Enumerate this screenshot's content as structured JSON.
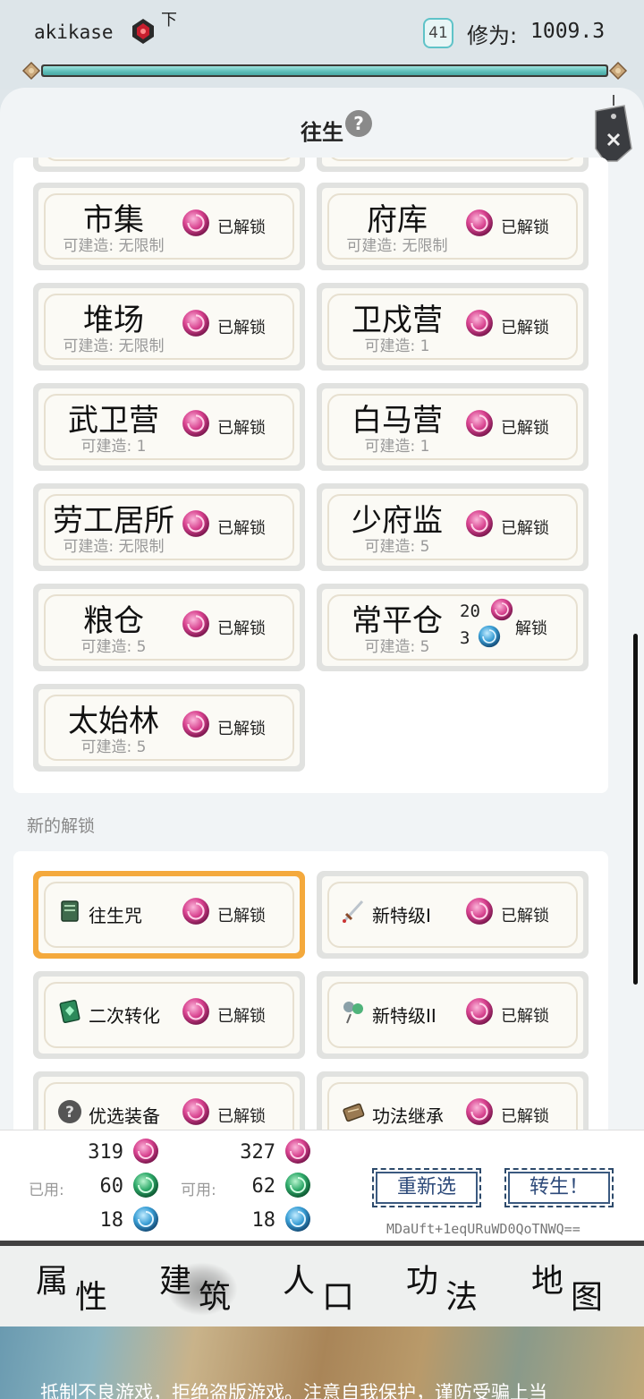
{
  "header": {
    "username": "akikase",
    "realm": "下",
    "level": "41",
    "cultivation_label": "修为:",
    "cultivation_value": "1009.3",
    "progress": 1.0
  },
  "panel": {
    "title": "往生",
    "help": "?"
  },
  "buildings": [
    {
      "name": "市集",
      "sub": "可建造: 无限制",
      "status": "已解锁"
    },
    {
      "name": "府库",
      "sub": "可建造: 无限制",
      "status": "已解锁"
    },
    {
      "name": "堆场",
      "sub": "可建造: 无限制",
      "status": "已解锁"
    },
    {
      "name": "卫戍营",
      "sub": "可建造: 1",
      "status": "已解锁"
    },
    {
      "name": "武卫营",
      "sub": "可建造: 1",
      "status": "已解锁"
    },
    {
      "name": "白马营",
      "sub": "可建造: 1",
      "status": "已解锁"
    },
    {
      "name": "劳工居所",
      "sub": "可建造: 无限制",
      "status": "已解锁"
    },
    {
      "name": "少府监",
      "sub": "可建造: 5",
      "status": "已解锁"
    },
    {
      "name": "粮仓",
      "sub": "可建造: 5",
      "status": "已解锁"
    },
    {
      "name": "常平仓",
      "sub": "可建造: 5",
      "status": "解锁",
      "cost1": "20",
      "cost2": "3"
    },
    {
      "name": "太始林",
      "sub": "可建造: 5",
      "status": "已解锁"
    }
  ],
  "new_unlocks_label": "新的解锁",
  "unlocks": [
    {
      "name": "往生咒",
      "status": "已解锁",
      "icon": "book-icon"
    },
    {
      "name": "新特级I",
      "status": "已解锁",
      "icon": "sword-icon"
    },
    {
      "name": "二次转化",
      "status": "已解锁",
      "icon": "gem-book-icon"
    },
    {
      "name": "新特级II",
      "status": "已解锁",
      "icon": "orbs-icon"
    },
    {
      "name": "优选装备",
      "status": "已解锁",
      "icon": "mystery-icon"
    },
    {
      "name": "功法继承",
      "status": "已解锁",
      "icon": "scroll-icon"
    }
  ],
  "resources": {
    "used_label": "已用:",
    "available_label": "可用:",
    "used": [
      "319",
      "60",
      "18"
    ],
    "available": [
      "327",
      "62",
      "18"
    ]
  },
  "buttons": {
    "reselect": "重新选",
    "rebirth": "转生！"
  },
  "code": "MDaUft+1eqURuWD0QoTNWQ==",
  "nav": [
    {
      "c1": "属",
      "c2": "性"
    },
    {
      "c1": "建",
      "c2": "筑"
    },
    {
      "c1": "人",
      "c2": "口"
    },
    {
      "c1": "功",
      "c2": "法"
    },
    {
      "c1": "地",
      "c2": "图"
    }
  ],
  "footer_text": "抵制不良游戏，拒绝盗版游戏。注意自我保护，谨防受骗上当",
  "colors": {
    "pink_orb": "#d8428f",
    "green_orb": "#2faa6a",
    "blue_orb": "#3a9fd6",
    "selected_border": "#f4a93c"
  }
}
